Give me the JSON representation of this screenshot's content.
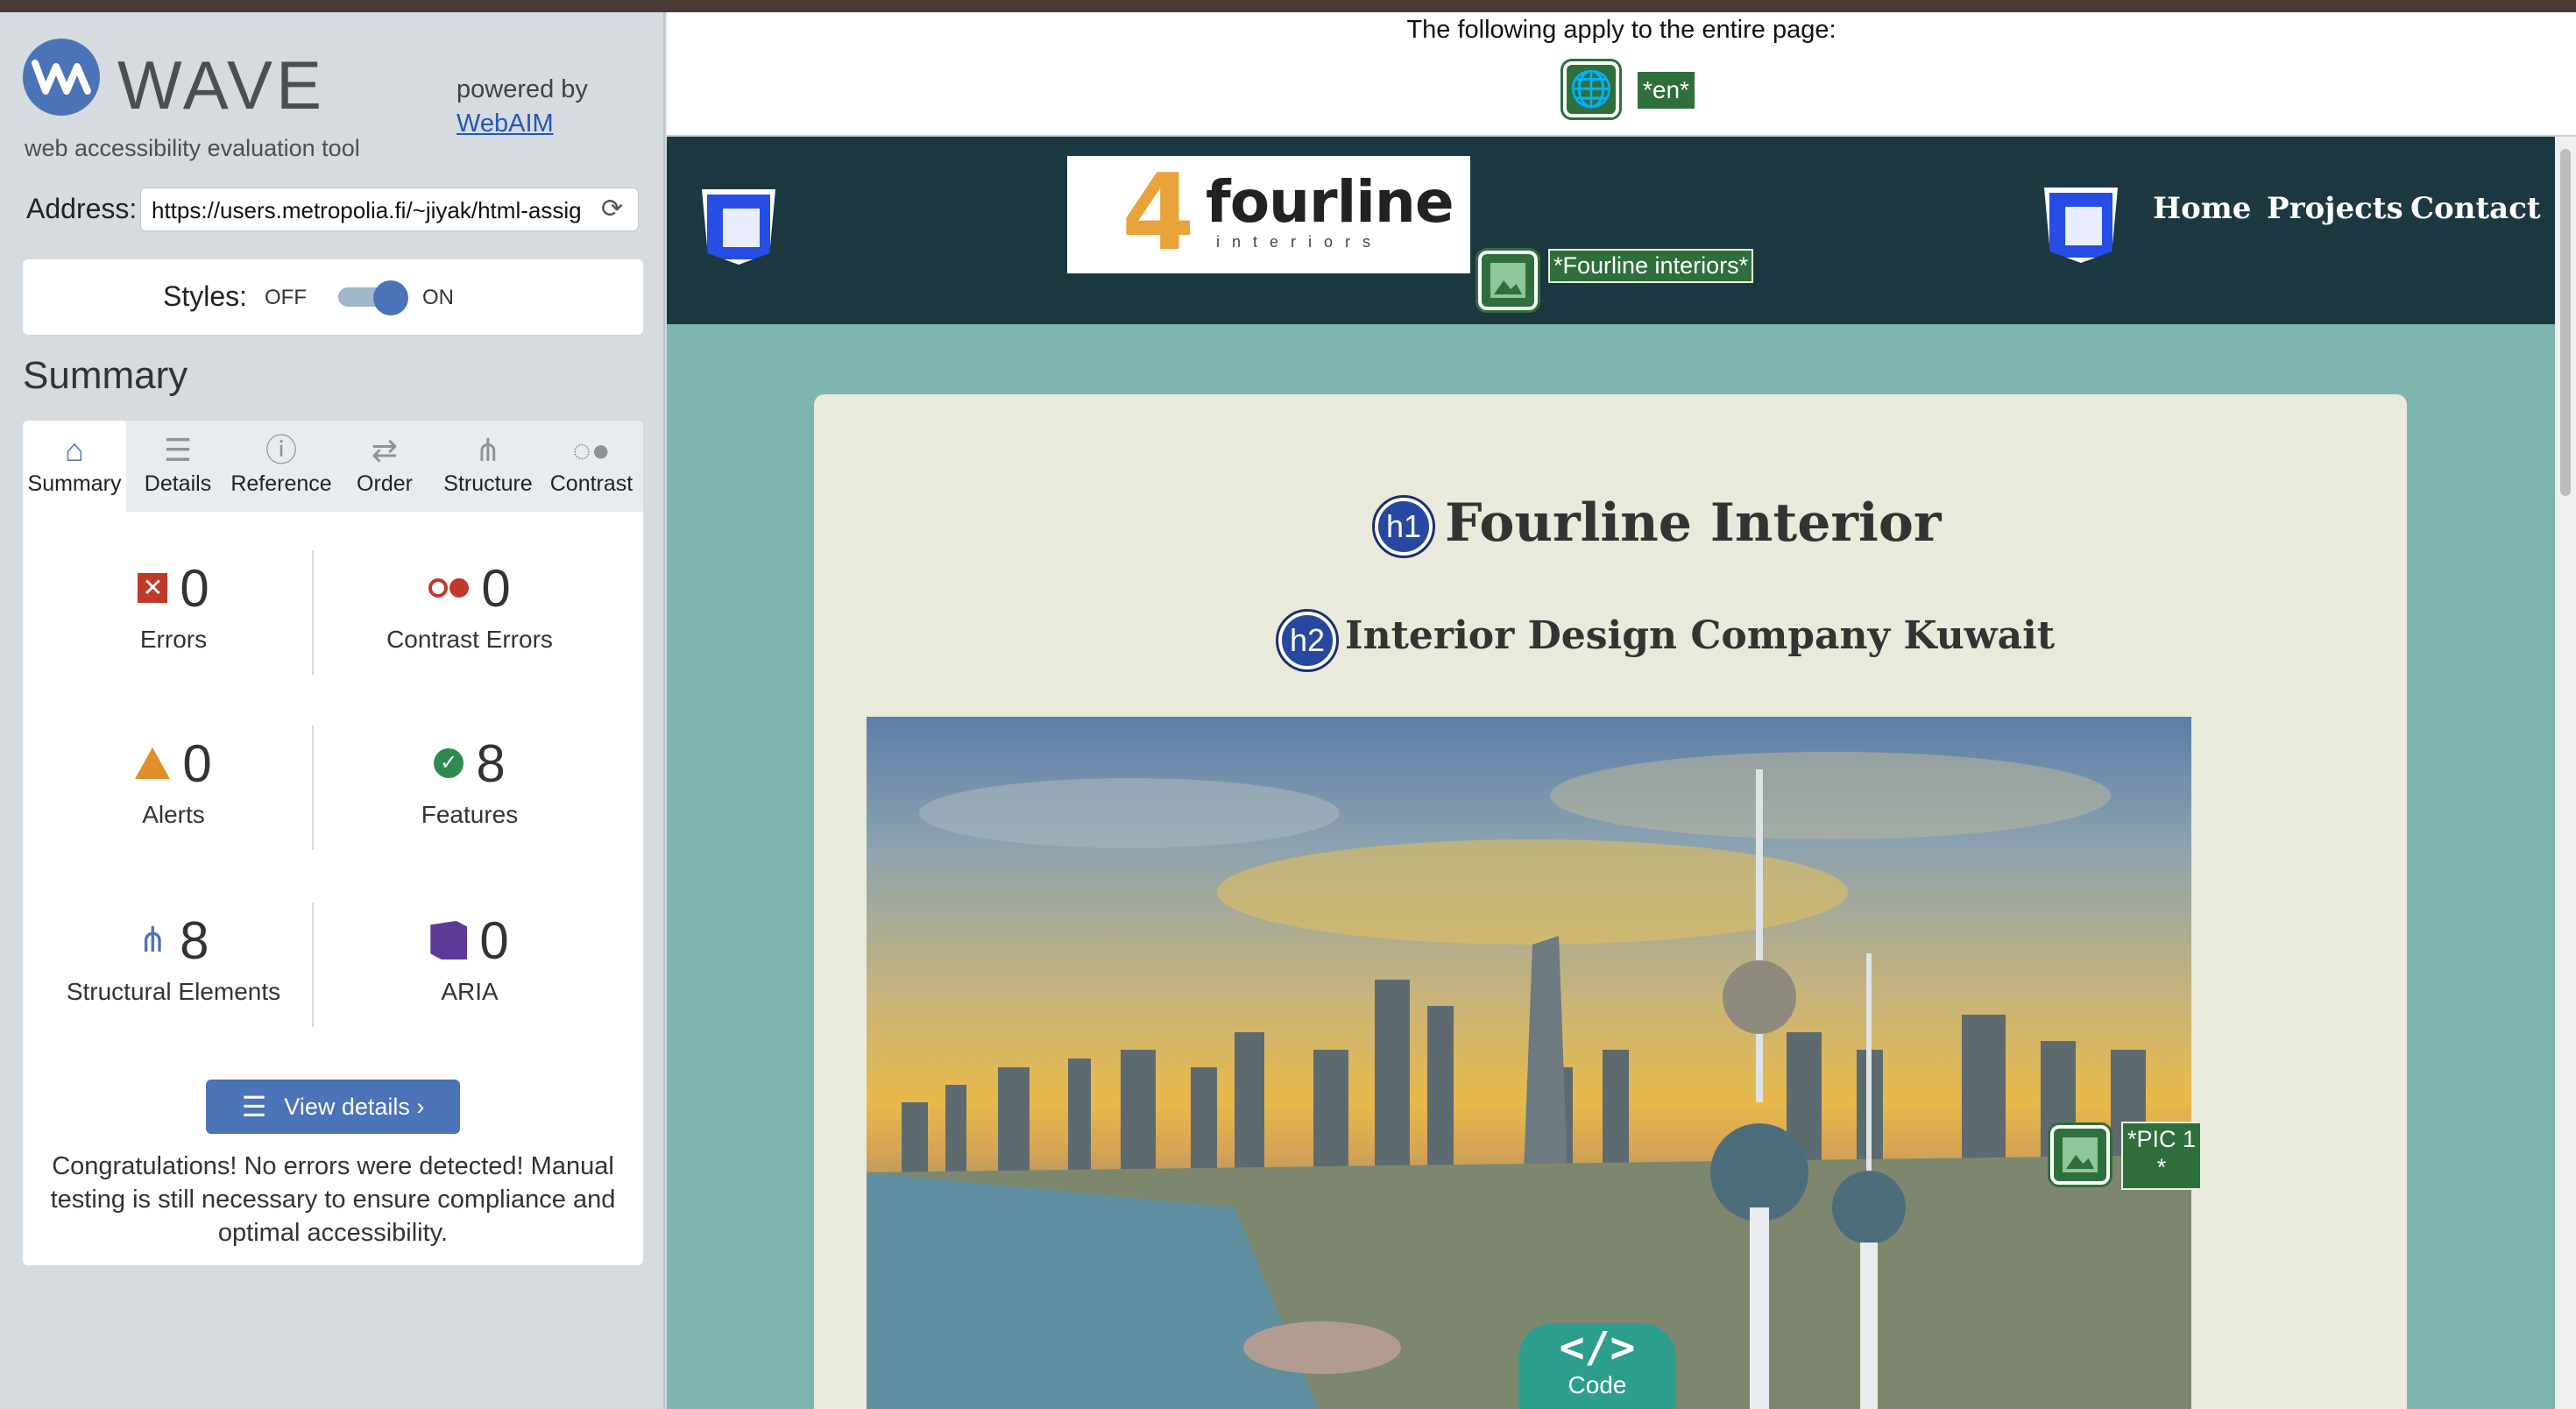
{
  "sidebar": {
    "brand": "WAVE",
    "tagline": "web accessibility evaluation tool",
    "powered_by": "powered by",
    "powered_link": "WebAIM",
    "address_label": "Address:",
    "address_value": "https://users.metropolia.fi/~jiyak/html-assig",
    "styles_label": "Styles:",
    "styles_off": "OFF",
    "styles_on": "ON",
    "summary_title": "Summary",
    "tabs": [
      {
        "label": "Summary",
        "icon": "home-icon"
      },
      {
        "label": "Details",
        "icon": "list-icon"
      },
      {
        "label": "Reference",
        "icon": "info-icon"
      },
      {
        "label": "Order",
        "icon": "order-icon"
      },
      {
        "label": "Structure",
        "icon": "structure-icon"
      },
      {
        "label": "Contrast",
        "icon": "contrast-icon"
      }
    ],
    "stats": {
      "errors": {
        "count": "0",
        "label": "Errors"
      },
      "contrast_errors": {
        "count": "0",
        "label": "Contrast Errors"
      },
      "alerts": {
        "count": "0",
        "label": "Alerts"
      },
      "features": {
        "count": "8",
        "label": "Features"
      },
      "structural": {
        "count": "8",
        "label": "Structural Elements"
      },
      "aria": {
        "count": "0",
        "label": "ARIA"
      }
    },
    "view_details": "View details ›",
    "congrats": "Congratulations! No errors were detected! Manual testing is still necessary to ensure compliance and optimal accessibility."
  },
  "page_banner": {
    "text": "The following apply to the entire page:",
    "lang": "*en*"
  },
  "site": {
    "logo_big": "4",
    "logo_word": "fourline",
    "logo_small": "interiors",
    "logo_alt": "*Fourline interiors*",
    "nav": [
      "Home",
      "Projects",
      "Contact"
    ],
    "h1_badge": "h1",
    "h1": "Fourline Interior",
    "h2_badge": "h2",
    "h2": "Interior Design Company Kuwait",
    "pic_alt": "*PIC 1 *",
    "code_tab_label": "Code",
    "code_tab_symbol": "</>"
  },
  "colors": {
    "wave_blue": "#4b73b8",
    "feature_green": "#2f6f3b",
    "site_header": "#1c3840",
    "site_bg": "#7db5b1",
    "card_bg": "#e9eadb"
  }
}
